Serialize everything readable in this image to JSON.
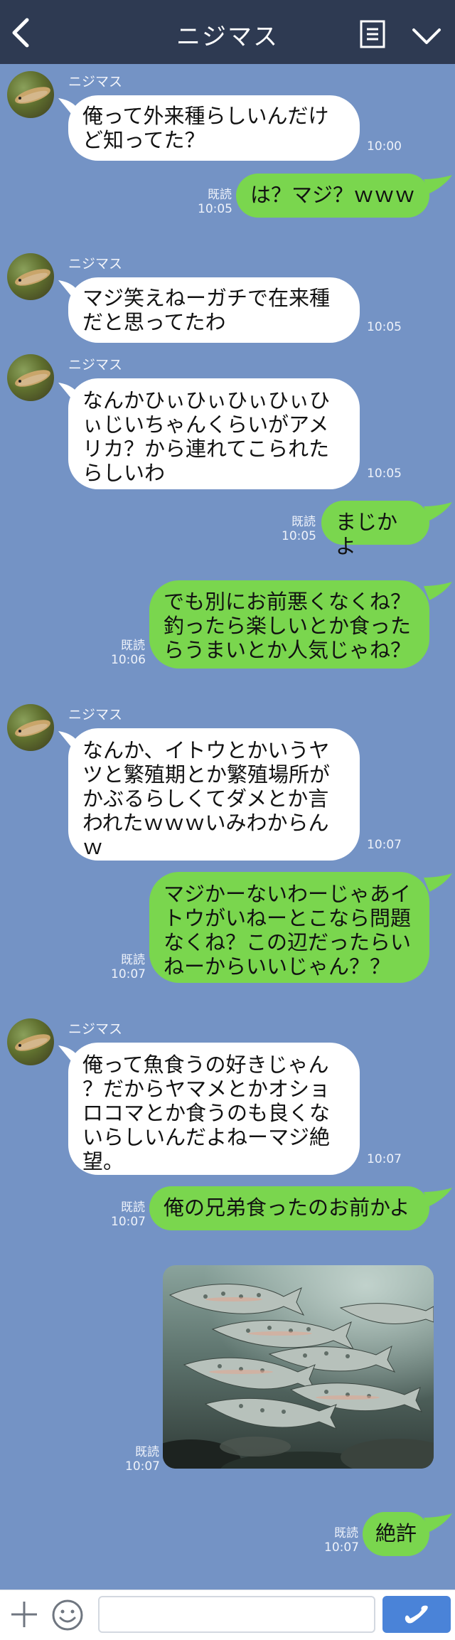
{
  "header": {
    "title": "ニジマス",
    "back_icon": "chevron-left-icon",
    "menu_icon": "menu-list-icon",
    "collapse_icon": "chevron-down-icon"
  },
  "colors": {
    "header_bg": "#2e3a52",
    "chat_bg": "#7493c5",
    "sent_bubble": "#7ad64e",
    "received_bubble": "#ffffff",
    "send_button": "#4a83d8"
  },
  "messages": [
    {
      "direction": "received",
      "sender": "ニジマス",
      "text": "俺って外来種らしいんだけ\nど知ってた？",
      "time": "10:00"
    },
    {
      "direction": "sent",
      "text": "は？マジ？ｗｗｗ",
      "read": "既読",
      "time": "10:05"
    },
    {
      "direction": "received",
      "sender": "ニジマス",
      "text": "マジ笑えねーガチで在来種\nだと思ってたわ",
      "time": "10:05"
    },
    {
      "direction": "received",
      "sender": "ニジマス",
      "text": "なんかひぃひぃひぃひぃひ\nぃじいちゃんくらいがアメ\nリカ？から連れてこられた\nらしいわ",
      "time": "10:05"
    },
    {
      "direction": "sent",
      "text": "まじかよ",
      "read": "既読",
      "time": "10:05"
    },
    {
      "direction": "sent",
      "text": "でも別にお前悪くなくね？\n釣ったら楽しいとか食った\nらうまいとか人気じゃね？",
      "read": "既読",
      "time": "10:06"
    },
    {
      "direction": "received",
      "sender": "ニジマス",
      "text": "なんか、イトウとかいうヤ\nツと繁殖期とか繁殖場所が\nかぶるらしくてダメとか言\nわれたｗｗｗいみわからん\nｗ",
      "time": "10:07"
    },
    {
      "direction": "sent",
      "text": "マジかーないわーじゃあイ\nトウがいねーとこなら問題\nなくね？この辺だったらい\nねーからいいじゃん？？",
      "read": "既読",
      "time": "10:07"
    },
    {
      "direction": "received",
      "sender": "ニジマス",
      "text": "俺って魚食うの好きじゃん\n？だからヤマメとかオショ\nロコマとか食うのも良くな\nいらしいんだよねーマジ絶\n望。",
      "time": "10:07"
    },
    {
      "direction": "sent",
      "text": "俺の兄弟食ったのお前かよ",
      "read": "既読",
      "time": "10:07"
    },
    {
      "direction": "sent",
      "image": "trout-school-photo",
      "read": "既読",
      "time": "10:07"
    },
    {
      "direction": "sent",
      "text": "絶許",
      "read": "既読",
      "time": "10:07"
    }
  ],
  "footer": {
    "add_icon": "plus-icon",
    "emoji_icon": "smiley-icon",
    "input_value": "",
    "send_icon": "phone-icon"
  }
}
